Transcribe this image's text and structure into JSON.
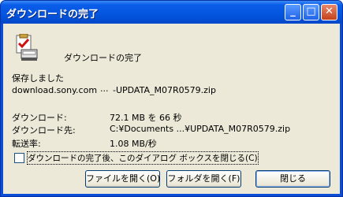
{
  "window": {
    "title": "ダウンロードの完了",
    "controls": {
      "minimize": "_",
      "maximize": "□",
      "close": "✕"
    }
  },
  "header": {
    "icon": "download-complete-icon",
    "text": "ダウンロードの完了"
  },
  "saved": {
    "label": "保存しました",
    "source": "download.sony.com",
    "ellipsis": "...",
    "file": "-UPDATA_M07R0579.zip"
  },
  "details": {
    "downloaded_label": "ダウンロード:",
    "downloaded_value": "72.1 MB を 66 秒",
    "dest_label": "ダウンロード先:",
    "dest_value": "C:¥Documents ...¥UPDATA_M07R0579.zip",
    "rate_label": "転送率:",
    "rate_value": "1.08 MB/秒"
  },
  "checkbox": {
    "label": "ダウンロードの完了後、このダイアログ ボックスを閉じる(C)",
    "checked": false
  },
  "buttons": {
    "open_file": "ファイルを開く(O)",
    "open_folder": "フォルダを開く(F)",
    "close": "閉じる"
  }
}
